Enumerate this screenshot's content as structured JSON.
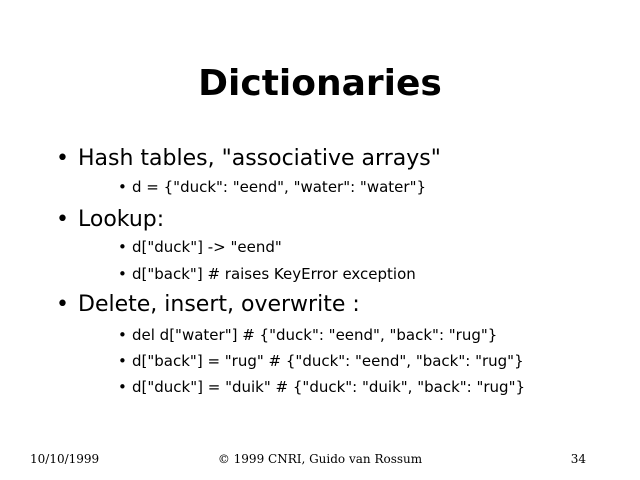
{
  "slide": {
    "title": "Dictionaries",
    "bullet_glyph": "•",
    "sections": [
      {
        "text": "Hash tables, \"associative arrays\"",
        "subitems": [
          "d = {\"duck\": \"eend\", \"water\": \"water\"}"
        ]
      },
      {
        "text": "Lookup:",
        "subitems": [
          "d[\"duck\"] -> \"eend\"",
          "d[\"back\"] # raises KeyError exception"
        ]
      },
      {
        "text": "Delete, insert, overwrite :",
        "subitems": [
          "del d[\"water\"] # {\"duck\": \"eend\", \"back\": \"rug\"}",
          "d[\"back\"] = \"rug\" # {\"duck\": \"eend\", \"back\": \"rug\"}",
          "d[\"duck\"] = \"duik\" # {\"duck\": \"duik\", \"back\": \"rug\"}"
        ]
      }
    ]
  },
  "footer": {
    "date": "10/10/1999",
    "copyright": "© 1999 CNRI, Guido van Rossum",
    "page_number": "34"
  }
}
